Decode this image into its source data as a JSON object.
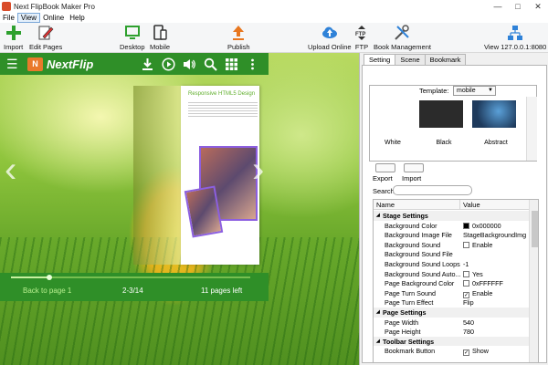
{
  "window": {
    "title": "Next FlipBook Maker Pro"
  },
  "menu": [
    "File",
    "View",
    "Online",
    "Help"
  ],
  "toolbar": {
    "import": "Import",
    "edit_pages": "Edit Pages",
    "desktop": "Desktop",
    "mobile": "Mobile",
    "publish": "Publish",
    "upload_online": "Upload Online",
    "ftp": "FTP",
    "book_management": "Book Management",
    "view_server": "View 127.0.0.1:8080"
  },
  "preview": {
    "brand": "NextFlip",
    "page_heading": "Responsive HTML5 Design",
    "back_label": "Back to page 1",
    "page_indicator": "2-3/14",
    "pages_left": "11 pages left",
    "progress_fraction": 0.16
  },
  "panel": {
    "tabs": [
      "Setting",
      "Scene",
      "Bookmark"
    ],
    "active_tab": "Setting",
    "template_label": "Template:",
    "template_value": "mobile",
    "templates": [
      {
        "name": "White",
        "color": "#f4f4f4"
      },
      {
        "name": "Black",
        "color": "#2b2b2b"
      },
      {
        "name": "Abstract",
        "color": "#1e3a5c"
      }
    ],
    "export_label": "Export",
    "import_label": "Import",
    "search_label": "Search:",
    "grid_headers": {
      "name": "Name",
      "value": "Value"
    },
    "rows": [
      {
        "type": "section",
        "name": "Stage Settings"
      },
      {
        "name": "Background Color",
        "value": "0x000000",
        "swatch": "#000000"
      },
      {
        "name": "Background Image File",
        "value": "StageBackgroundImg"
      },
      {
        "name": "Background Sound",
        "value": "Enable",
        "check": false
      },
      {
        "name": "Background Sound File",
        "value": ""
      },
      {
        "name": "Background Sound Loops",
        "value": "-1"
      },
      {
        "name": "Background Sound Auto...",
        "value": "Yes",
        "check": false
      },
      {
        "name": "Page Background Color",
        "value": "0xFFFFFF",
        "swatch": "#ffffff"
      },
      {
        "name": "Page Turn Sound",
        "value": "Enable",
        "check": true
      },
      {
        "name": "Page Turn Effect",
        "value": "Flip"
      },
      {
        "type": "section",
        "name": "Page Settings"
      },
      {
        "name": "Page Width",
        "value": "540"
      },
      {
        "name": "Page Height",
        "value": "780"
      },
      {
        "type": "section",
        "name": "Toolbar Settings"
      },
      {
        "name": "Bookmark Button",
        "value": "Show",
        "check": true
      }
    ]
  }
}
